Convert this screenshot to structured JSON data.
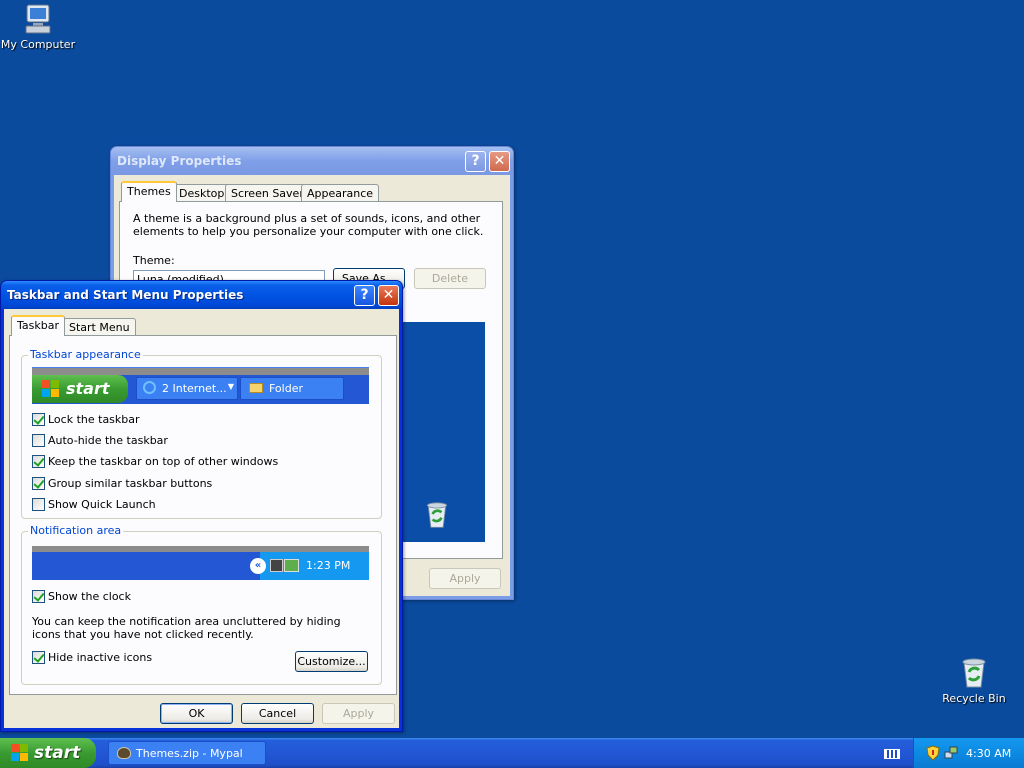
{
  "desktop": {
    "icons": [
      {
        "name": "my-computer",
        "label": "My Computer"
      },
      {
        "name": "recycle-bin",
        "label": "Recycle Bin"
      }
    ]
  },
  "display_properties": {
    "title": "Display Properties",
    "tabs": [
      "Themes",
      "Desktop",
      "Screen Saver",
      "Appearance"
    ],
    "description": "A theme is a background plus a set of sounds, icons, and other elements to help you personalize your computer with one click.",
    "theme_label": "Theme:",
    "theme_value": "Luna (modified)",
    "save_as_label": "Save As...",
    "delete_label": "Delete",
    "apply_label": "Apply"
  },
  "taskbar_properties": {
    "title": "Taskbar and Start Menu Properties",
    "tabs": [
      "Taskbar",
      "Start Menu"
    ],
    "appearance_group": "Taskbar appearance",
    "preview": {
      "start": "start",
      "button1": "2 Internet...",
      "button2": "Folder"
    },
    "options": [
      {
        "label": "Lock the taskbar",
        "checked": true
      },
      {
        "label": "Auto-hide the taskbar",
        "checked": false
      },
      {
        "label": "Keep the taskbar on top of other windows",
        "checked": true
      },
      {
        "label": "Group similar taskbar buttons",
        "checked": true
      },
      {
        "label": "Show Quick Launch",
        "checked": false
      }
    ],
    "notification_group": "Notification area",
    "notification_preview_time": "1:23 PM",
    "show_clock": {
      "label": "Show the clock",
      "checked": true
    },
    "notification_desc": "You can keep the notification area uncluttered by hiding icons that you have not clicked recently.",
    "hide_inactive": {
      "label": "Hide inactive icons",
      "checked": true
    },
    "customize_label": "Customize...",
    "ok_label": "OK",
    "cancel_label": "Cancel",
    "apply_label": "Apply"
  },
  "taskbar": {
    "start_label": "start",
    "task_label": "Themes.zip - Mypal",
    "clock": "4:30 AM"
  }
}
